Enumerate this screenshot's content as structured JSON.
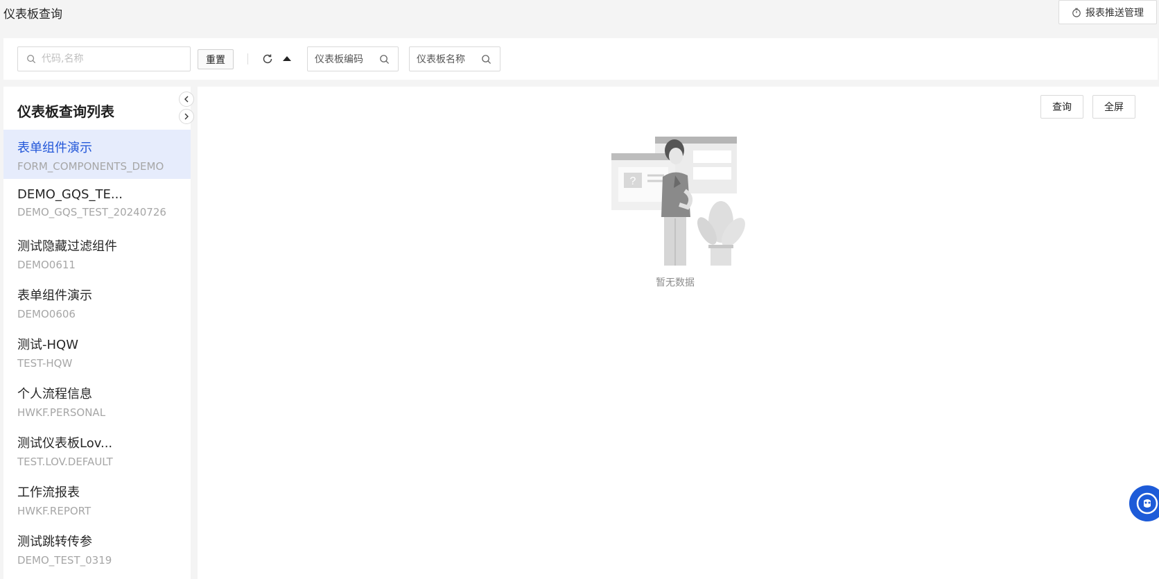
{
  "header": {
    "title": "仪表板查询",
    "push_button_label": "报表推送管理",
    "push_icon": "stopwatch-icon"
  },
  "filters": {
    "search_placeholder": "代码,名称",
    "search_value": "",
    "reset_label": "重置",
    "code_field_label": "仪表板编码",
    "name_field_label": "仪表板名称"
  },
  "sidebar": {
    "title": "仪表板查询列表",
    "items": [
      {
        "name": "表单组件演示",
        "code": "FORM_COMPONENTS_DEMO"
      },
      {
        "name": "DEMO_GQS_TE...",
        "code": "DEMO_GQS_TEST_20240726"
      },
      {
        "name": "测试隐藏过滤组件",
        "code": "DEMO0611"
      },
      {
        "name": "表单组件演示",
        "code": "DEMO0606"
      },
      {
        "name": "测试-HQW",
        "code": "TEST-HQW"
      },
      {
        "name": "个人流程信息",
        "code": "HWKF.PERSONAL"
      },
      {
        "name": "测试仪表板Lov...",
        "code": "TEST.LOV.DEFAULT"
      },
      {
        "name": "工作流报表",
        "code": "HWKF.REPORT"
      },
      {
        "name": "测试跳转传参",
        "code": "DEMO_TEST_0319"
      }
    ],
    "active_index": 0
  },
  "main": {
    "query_label": "查询",
    "fullscreen_label": "全屏",
    "empty_text": "暂无数据"
  },
  "colors": {
    "accent": "#2357d9",
    "active_bg": "#e6ecfc",
    "page_bg": "#f4f4f4"
  }
}
